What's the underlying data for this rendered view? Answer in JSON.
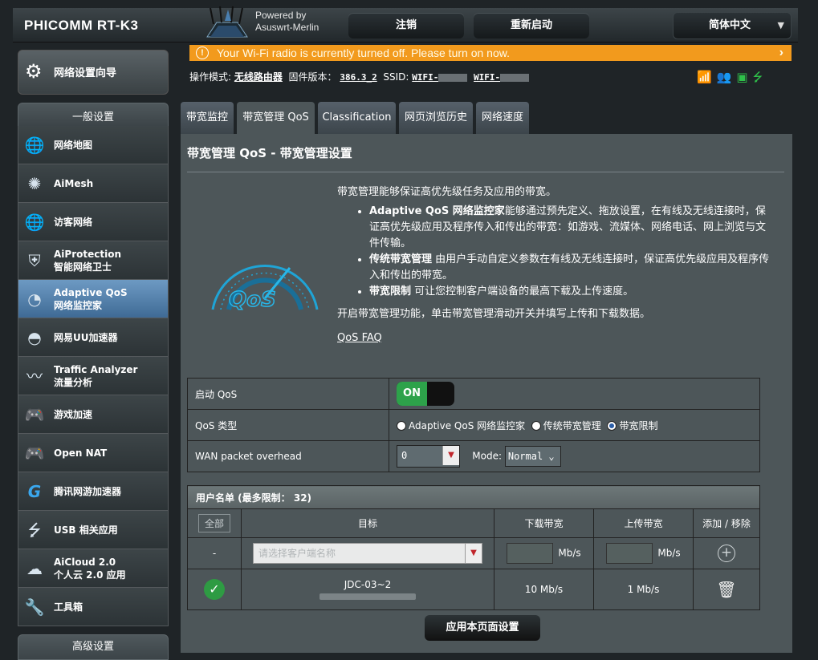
{
  "header": {
    "brand": "PHICOMM RT-K3",
    "powered_line1": "Powered by",
    "powered_line2": "Asuswrt-Merlin",
    "logout": "注销",
    "reboot": "重新启动",
    "language": "简体中文"
  },
  "alert": {
    "message": "Your Wi-Fi radio is currently turned off. Please turn on now."
  },
  "status": {
    "mode_label": "操作模式:",
    "mode_value": "无线路由器",
    "fw_label": "固件版本：",
    "fw_value": "386.3_2",
    "ssid_label": "SSID:",
    "ssid1": "WIFI-",
    "ssid2": "WIFI-"
  },
  "sidebar": {
    "wizard": "网络设置向导",
    "general_title": "一般设置",
    "items": [
      {
        "line1": "网络地图",
        "line2": "",
        "icon": "globe-icon"
      },
      {
        "line1": "AiMesh",
        "line2": "",
        "icon": "mesh-icon"
      },
      {
        "line1": "访客网络",
        "line2": "",
        "icon": "guest-globe-icon"
      },
      {
        "line1": "AiProtection",
        "line2": "智能网络卫士",
        "icon": "shield-icon"
      },
      {
        "line1": "Adaptive QoS",
        "line2": "网络监控家",
        "icon": "gauge-icon"
      },
      {
        "line1": "网易UU加速器",
        "line2": "",
        "icon": "speedometer-icon"
      },
      {
        "line1": "Traffic Analyzer",
        "line2": "流量分析",
        "icon": "waveform-icon"
      },
      {
        "line1": "游戏加速",
        "line2": "",
        "icon": "gamepad-icon"
      },
      {
        "line1": "Open NAT",
        "line2": "",
        "icon": "gamepad-globe-icon"
      },
      {
        "line1": "腾讯网游加速器",
        "line2": "",
        "icon": "tencent-g-icon"
      },
      {
        "line1": "USB 相关应用",
        "line2": "",
        "icon": "usb-icon"
      },
      {
        "line1": "AiCloud 2.0",
        "line2": "个人云 2.0 应用",
        "icon": "cloud-icon"
      },
      {
        "line1": "工具箱",
        "line2": "",
        "icon": "wrench-icon"
      }
    ],
    "advanced_title": "高级设置"
  },
  "tabs": [
    "带宽监控",
    "带宽管理 QoS",
    "Classification",
    "网页浏览历史",
    "网络速度"
  ],
  "page": {
    "title": "带宽管理 QoS - 带宽管理设置",
    "intro": "带宽管理能够保证高优先级任务及应用的带宽。",
    "bullet1_b": "Adaptive QoS 网络监控家",
    "bullet1": "能够通过预先定义、拖放设置，在有线及无线连接时，保证高优先级应用及程序传入和传出的带宽：如游戏、流媒体、网络电话、网上浏览与文件传输。",
    "bullet2_b": "传统带宽管理",
    "bullet2": " 由用户手动自定义参数在有线及无线连接时，保证高优先级应用及程序传入和传出的带宽。",
    "bullet3_b": "带宽限制",
    "bullet3": " 可让您控制客户端设备的最高下载及上传速度。",
    "enable_hint": "开启带宽管理功能，单击带宽管理滑动开关并填写上传和下载数据。",
    "faq": "QoS FAQ"
  },
  "settings": {
    "enable_label": "启动 QoS",
    "toggle": "ON",
    "type_label": "QoS 类型",
    "type_options": [
      "Adaptive QoS 网络监控家",
      "传统带宽管理",
      "带宽限制"
    ],
    "type_selected": "带宽限制",
    "wan_label": "WAN packet overhead",
    "wan_value": "0",
    "mode_label": "Mode:",
    "mode_value": "Normal"
  },
  "client_list": {
    "title": "用户名单 (最多限制： 32)",
    "all_btn": "全部",
    "col_target": "目标",
    "col_down": "下载带宽",
    "col_up": "上传带宽",
    "col_action": "添加 / 移除",
    "new_row_dash": "-",
    "target_placeholder": "请选择客户端名称",
    "unit": "Mb/s",
    "rows": [
      {
        "name": "JDC-03~2",
        "down": "10 Mb/s",
        "up": "1 Mb/s"
      }
    ]
  },
  "apply_button": "应用本页面设置"
}
